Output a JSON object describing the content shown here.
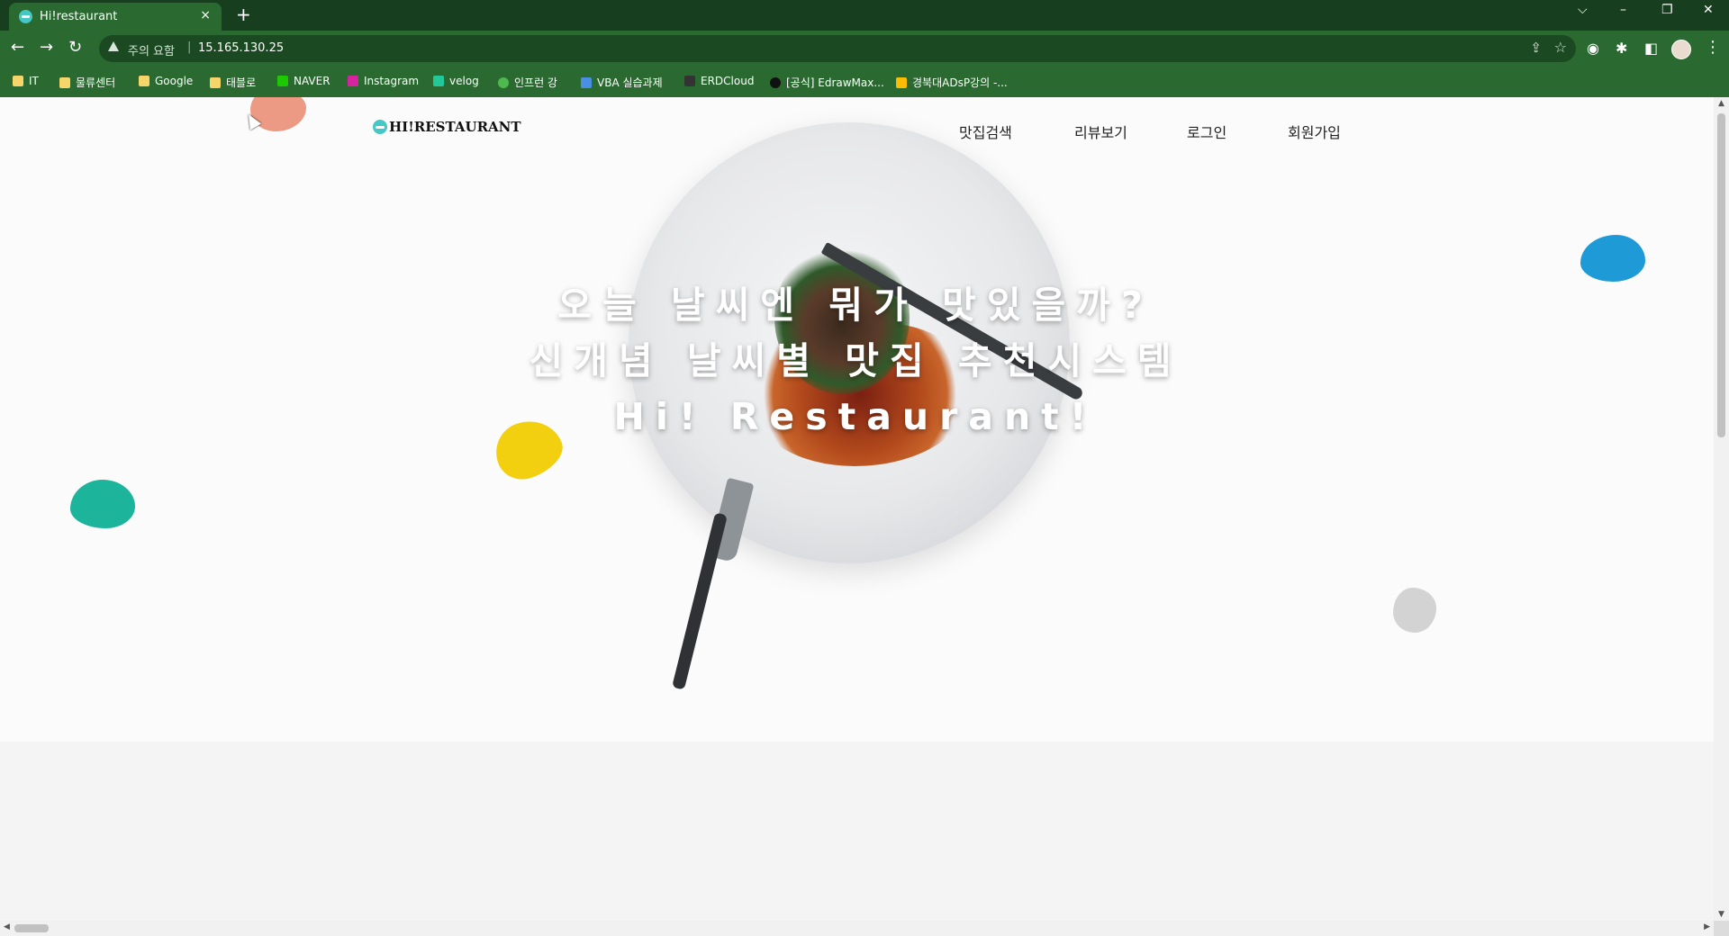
{
  "browser": {
    "tab_title": "Hi!restaurant",
    "tab_close": "×",
    "new_tab": "+",
    "window_controls": {
      "tab_list": "⌵",
      "minimize": "–",
      "restore": "❐",
      "close": "✕"
    },
    "nav": {
      "back": "←",
      "forward": "→",
      "reload": "↻"
    },
    "security_warning": "주의 요함",
    "separator": "|",
    "url": "15.165.130.25",
    "toolbar_icons": {
      "share": "⇪",
      "star": "☆",
      "screenshot": "◉",
      "extensions": "✱",
      "sidepanel": "◧",
      "menu": "⋮"
    }
  },
  "bookmarks": [
    {
      "label": "IT",
      "icon": "folder-icon",
      "color": "#f6d66a"
    },
    {
      "label": "물류센터",
      "icon": "folder-icon",
      "color": "#f6d66a"
    },
    {
      "label": "Google",
      "icon": "folder-icon",
      "color": "#f6d66a"
    },
    {
      "label": "태블로",
      "icon": "folder-icon",
      "color": "#f6d66a"
    },
    {
      "label": "NAVER",
      "icon": "naver-icon",
      "color": "#1ec800"
    },
    {
      "label": "Instagram",
      "icon": "instagram-icon",
      "color": "#d6249f"
    },
    {
      "label": "velog",
      "icon": "velog-icon",
      "color": "#20c997"
    },
    {
      "label": "인프런 강",
      "icon": "inflearn-icon",
      "color": "#4fb84f"
    },
    {
      "label": "VBA 실습과제",
      "icon": "vba-icon",
      "color": "#4a90e2"
    },
    {
      "label": "ERDCloud",
      "icon": "erd-icon",
      "color": "#333333"
    },
    {
      "label": "[공식] EdrawMax...",
      "icon": "edraw-icon",
      "color": "#111111"
    },
    {
      "label": "경북대ADsP강의 -...",
      "icon": "drive-icon",
      "color": "#fbbc04"
    }
  ],
  "site": {
    "logo_text": "HI!RESTAURANT",
    "nav": [
      "맛집검색",
      "리뷰보기",
      "로그인",
      "회원가입"
    ],
    "hero_lines": [
      "오늘 날씨엔 뭐가 맛있을까?",
      "신개념 날씨별 맛집 추천시스템",
      "Hi! Restaurant!"
    ]
  },
  "scrollbar": {
    "up": "▲",
    "down": "▼",
    "left": "◀",
    "right": "▶"
  }
}
